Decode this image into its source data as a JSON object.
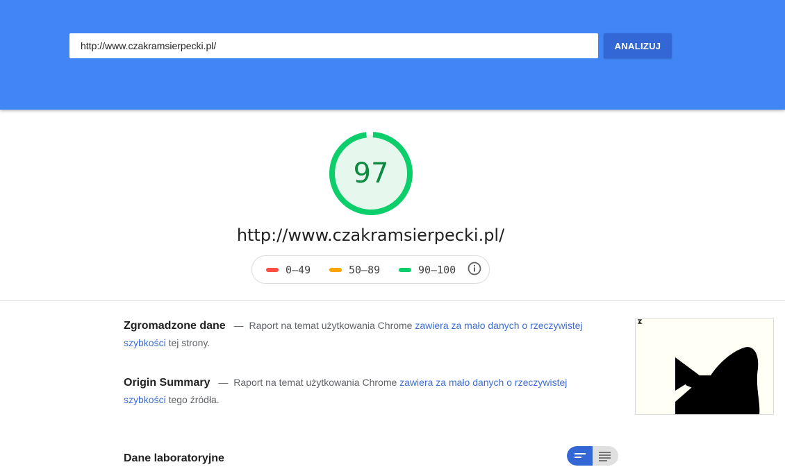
{
  "search": {
    "url_value": "http://www.czakramsierpecki.pl/",
    "analyze_label": "ANALIZUJ"
  },
  "score": {
    "value": "97",
    "fraction": 0.97,
    "color": "#0cce6b"
  },
  "tested_url": "http://www.czakramsierpecki.pl/",
  "legend": {
    "items": [
      {
        "range": "0–49",
        "color": "#ff4e42"
      },
      {
        "range": "50–89",
        "color": "#ffa400"
      },
      {
        "range": "90–100",
        "color": "#0cce6b"
      }
    ],
    "info_icon": "info-icon"
  },
  "field_data": {
    "title": "Zgromadzone dane",
    "dash": "—",
    "text_before": "Raport na temat użytkowania Chrome",
    "link": "zawiera za mało danych o rzeczywistej szybkości",
    "text_after": "tej strony."
  },
  "origin_summary": {
    "title": "Origin Summary",
    "dash": "—",
    "text_before": "Raport na temat użytkowania Chrome",
    "link": "zawiera za mało danych o rzeczywistej szybkości",
    "text_after": "tego źródła."
  },
  "lab_data": {
    "title": "Dane laboratoryjne"
  },
  "view_toggle": {
    "left_icon": "list-view-icon",
    "right_icon": "text-view-icon"
  },
  "colors": {
    "header": "#4285f4",
    "button": "#3367d6",
    "link": "#3c6fd6"
  }
}
